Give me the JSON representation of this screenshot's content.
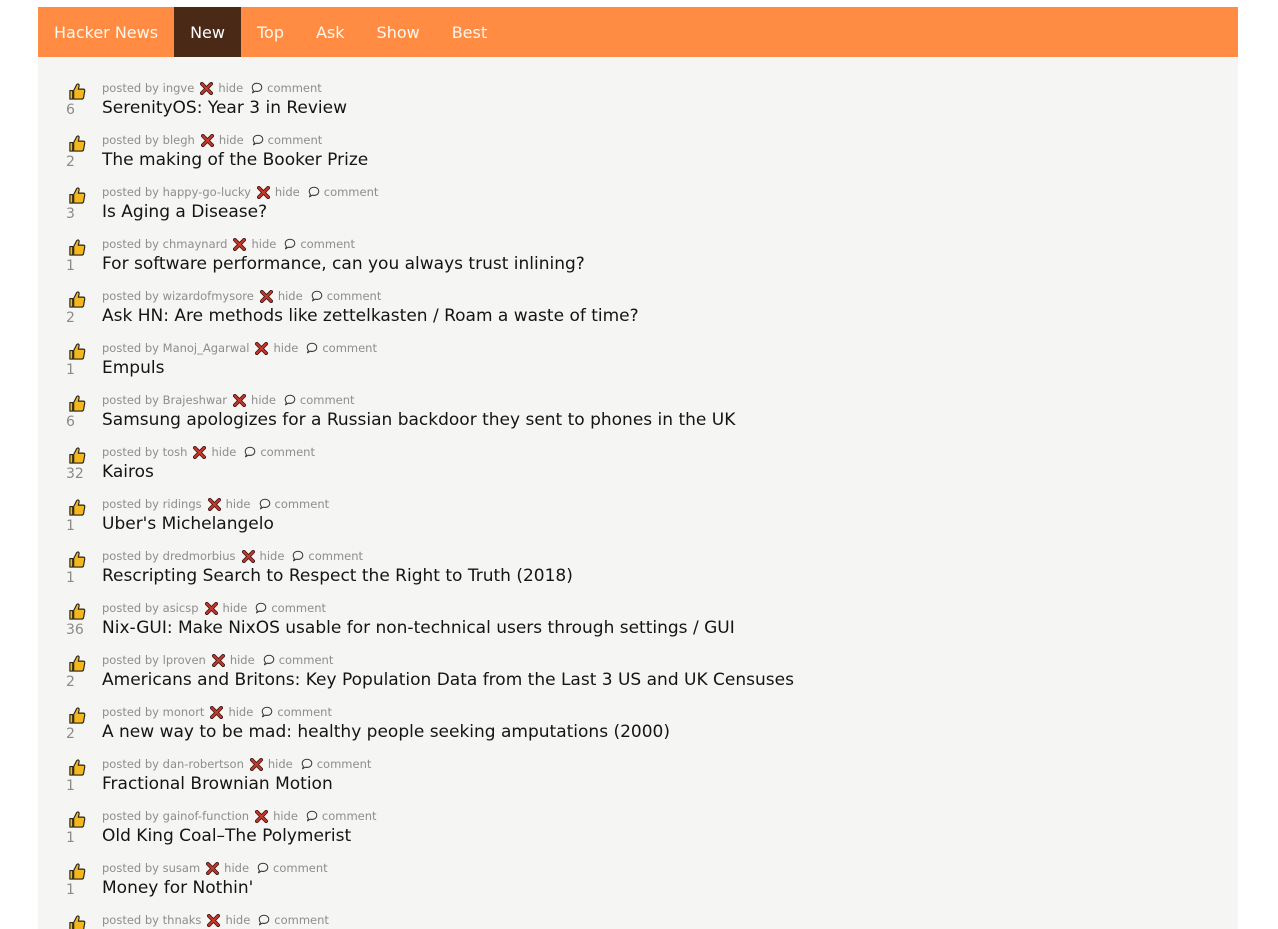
{
  "nav": {
    "items": [
      "Hacker News",
      "New",
      "Top",
      "Ask",
      "Show",
      "Best"
    ],
    "active_index": 1
  },
  "labels": {
    "posted_by": "posted by",
    "hide": "hide",
    "comment": "comment"
  },
  "colors": {
    "nav_bg": "#ff8c42",
    "nav_active_bg": "#4a2a17",
    "thumb": "#f5b81c",
    "hide_x": "#c0392b"
  },
  "icons": {
    "vote": "thumbs-up-icon",
    "hide": "x-mark-icon",
    "comment": "speech-bubble-icon"
  },
  "posts": [
    {
      "author": "ingve",
      "score": "6",
      "title": "SerenityOS: Year 3 in Review"
    },
    {
      "author": "blegh",
      "score": "2",
      "title": "The making of the Booker Prize"
    },
    {
      "author": "happy-go-lucky",
      "score": "3",
      "title": "Is Aging a Disease?"
    },
    {
      "author": "chmaynard",
      "score": "1",
      "title": "For software performance, can you always trust inlining?"
    },
    {
      "author": "wizardofmysore",
      "score": "2",
      "title": "Ask HN: Are methods like zettelkasten / Roam a waste of time?"
    },
    {
      "author": "Manoj_Agarwal",
      "score": "1",
      "title": "Empuls"
    },
    {
      "author": "Brajeshwar",
      "score": "6",
      "title": "Samsung apologizes for a Russian backdoor they sent to phones in the UK"
    },
    {
      "author": "tosh",
      "score": "32",
      "title": "Kairos"
    },
    {
      "author": "ridings",
      "score": "1",
      "title": "Uber's Michelangelo"
    },
    {
      "author": "dredmorbius",
      "score": "1",
      "title": "Rescripting Search to Respect the Right to Truth (2018)"
    },
    {
      "author": "asicsp",
      "score": "36",
      "title": "Nix-GUI: Make NixOS usable for non-technical users through settings / GUI"
    },
    {
      "author": "lproven",
      "score": "2",
      "title": "Americans and Britons: Key Population Data from the Last 3 US and UK Censuses"
    },
    {
      "author": "monort",
      "score": "2",
      "title": "A new way to be mad: healthy people seeking amputations (2000)"
    },
    {
      "author": "dan-robertson",
      "score": "1",
      "title": "Fractional Brownian Motion"
    },
    {
      "author": "gainof-function",
      "score": "1",
      "title": "Old King Coal–The Polymerist"
    },
    {
      "author": "susam",
      "score": "1",
      "title": "Money for Nothin'"
    },
    {
      "author": "thnaks",
      "score": "",
      "title": ""
    }
  ]
}
